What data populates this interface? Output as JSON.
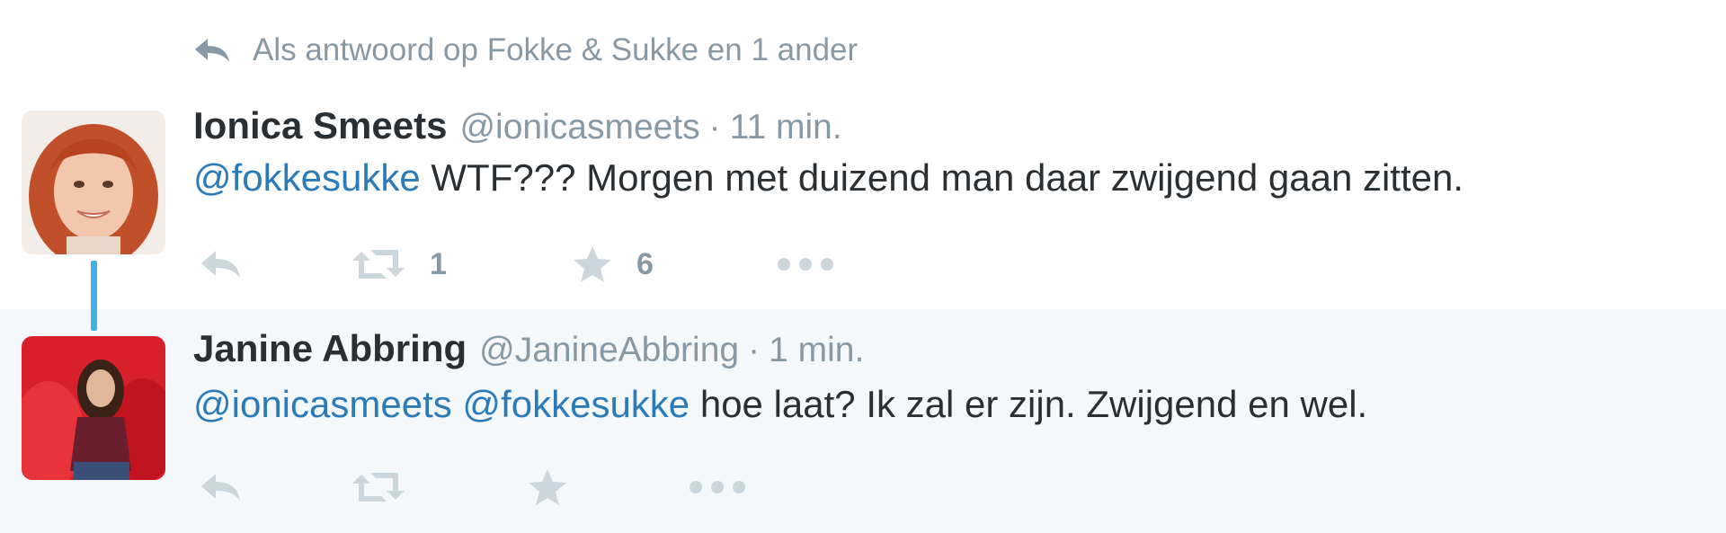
{
  "reply_context": {
    "icon": "reply-arrow-icon",
    "text": "Als antwoord op Fokke & Sukke en 1 ander"
  },
  "tweets": [
    {
      "name": "Ionica Smeets",
      "handle": "@ionicasmeets",
      "separator": "·",
      "time": "11 min.",
      "mentions": [
        "@fokkesukke"
      ],
      "text": " WTF??? Morgen met duizend man daar zwijgend gaan zitten.",
      "retweets": "1",
      "favorites": "6"
    },
    {
      "name": "Janine Abbring",
      "handle": "@JanineAbbring",
      "separator": "·",
      "time": "1 min.",
      "mentions": [
        "@ionicasmeets",
        "@fokkesukke"
      ],
      "text": " hoe laat? Ik zal er zijn. Zwijgend en wel.",
      "retweets": "",
      "favorites": ""
    }
  ],
  "colors": {
    "link": "#2b7bb9",
    "muted": "#8899a6",
    "thread_line": "#3fb1e3",
    "highlight_bg": "#f5f8fa",
    "icon": "#ccd6dd"
  }
}
